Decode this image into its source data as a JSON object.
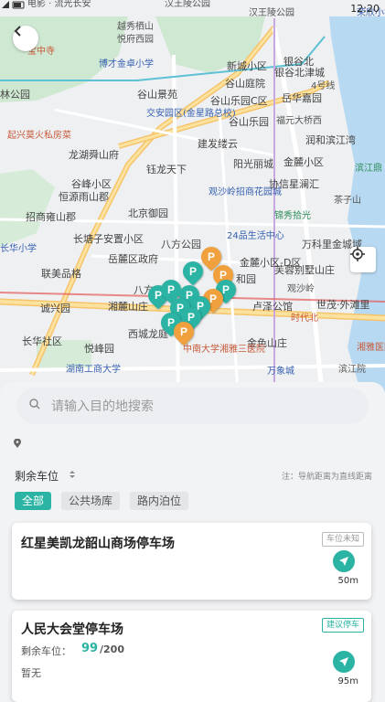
{
  "status": {
    "time": "12:20"
  },
  "map": {
    "labels": [
      "电影 · 流光长安",
      "汉王陵公园",
      "汉王陵公园",
      "越秀栖山",
      "悦府西园",
      "宝中寺",
      "博才金卓小学",
      "新城小区",
      "银谷北津城",
      "谷山景苑",
      "谷山庭院",
      "谷山乐园C区",
      "岳华嘉园",
      "4号线",
      "交安园区(金星路总校)",
      "谷山乐园",
      "福元大桥西",
      "起兴莫火私房菜",
      "建发缕云",
      "润和滨江湾",
      "龙湖舜山府",
      "钰龙天下",
      "阳光丽城",
      "金麓小区",
      "滨江鼎",
      "谷峰小区",
      "恒源雨山郡",
      "观沙岭招商花园城",
      "协信星澜汇",
      "茶子山",
      "招商雍山郡",
      "北京御园",
      "锦秀拾光",
      "24品生活中心",
      "长塘子安置小区",
      "八方公园",
      "万科里金城域",
      "岳麓区政府",
      "联美品格",
      "金麓小区-D区",
      "芙蓉别墅山庄",
      "和园",
      "湘麓山庄",
      "观沙岭",
      "卢泽公馆",
      "诚兴园",
      "世茂·外滩里",
      "时代北",
      "长华社区",
      "西城龙庭",
      "金色山庄",
      "悦峰园",
      "中南大学湘雅三医院",
      "湘雅医院",
      "湖南工商大学",
      "万象城",
      "滨江院",
      "长华小学",
      "林公园",
      "八方",
      "银谷北",
      "荣欣小学"
    ]
  },
  "search": {
    "placeholder": "请输入目的地搜索"
  },
  "section": {
    "title": "剩余车位",
    "note": "注：导航距离为直线距离"
  },
  "filters": [
    "全部",
    "公共场库",
    "路内泊位"
  ],
  "cards": [
    {
      "title": "红星美凯龙韶山商场停车场",
      "tag": "车位未知",
      "distance": "50m"
    },
    {
      "title": "人民大会堂停车场",
      "tag": "建议停车",
      "spots_label": "剩余车位：",
      "spots_free": "99",
      "spots_total": "/200",
      "extra": "暂无",
      "distance": "95m"
    }
  ],
  "colors": {
    "accent": "#2bb3a3",
    "pin_orange": "#f0a03c"
  }
}
